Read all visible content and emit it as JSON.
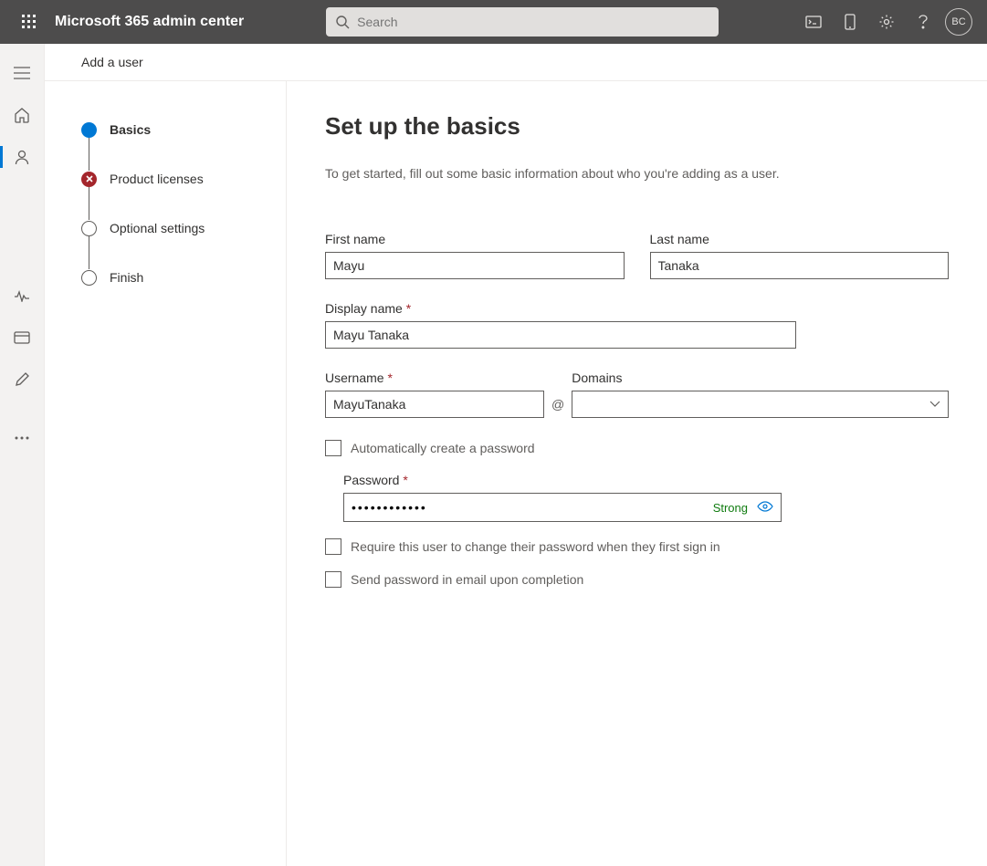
{
  "header": {
    "app_title": "Microsoft 365 admin center",
    "search_placeholder": "Search",
    "avatar_initials": "BC"
  },
  "page": {
    "title": "Add a user"
  },
  "steps": [
    {
      "label": "Basics"
    },
    {
      "label": "Product licenses"
    },
    {
      "label": "Optional settings"
    },
    {
      "label": "Finish"
    }
  ],
  "form": {
    "heading": "Set up the basics",
    "description": "To get started, fill out some basic information about who you're adding as a user.",
    "first_name_label": "First name",
    "first_name_value": "Mayu",
    "last_name_label": "Last name",
    "last_name_value": "Tanaka",
    "display_name_label": "Display name",
    "display_name_value": "Mayu Tanaka",
    "username_label": "Username",
    "username_value": "MayuTanaka",
    "at_symbol": "@",
    "domains_label": "Domains",
    "domains_value": "",
    "auto_password_label": "Automatically create a password",
    "password_label": "Password",
    "password_value": "••••••••••••",
    "password_strength": "Strong",
    "require_change_label": "Require this user to change their password when they first sign in",
    "send_email_label": "Send password in email upon completion"
  }
}
